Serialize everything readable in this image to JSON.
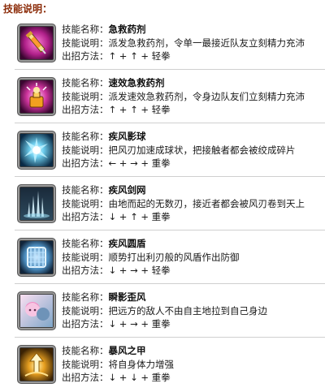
{
  "header": {
    "title": "技能说明："
  },
  "labels": {
    "name": "技能名称：",
    "desc": "技能说明：",
    "method": "出招方法："
  },
  "skills": [
    {
      "icon": "potion-syringe-icon",
      "name": "急救药剂",
      "desc": "派发急救药剂，令单一最接近队友立刻精力充沛",
      "method": "↑ + ↑ + 轻拳"
    },
    {
      "icon": "quick-potion-icon",
      "name": "速效急救药剂",
      "desc": "派发速效急救药剂，令身边队友们立刻精力充沛",
      "method": "↑ + ↑ + 轻拳"
    },
    {
      "icon": "wind-sphere-icon",
      "name": "疾风影球",
      "desc": "把风刃加速成球状，把接触者都会被绞成碎片",
      "method": "← + → + 重拳"
    },
    {
      "icon": "wind-sword-net-icon",
      "name": "疾风剑网",
      "desc": "由地而起的无数刃，接近者都会被风刃卷到天上",
      "method": "↓ + ↑ + 重拳"
    },
    {
      "icon": "wind-shield-icon",
      "name": "疾风圆盾",
      "desc": "顺势打出利刃般的风盾作出防御",
      "method": "↓ + → + 轻拳"
    },
    {
      "icon": "shadow-wind-icon",
      "name": "瞬影歪风",
      "desc": "把远方的敌人不由自主地拉到自己身边",
      "method": "↓ + → + 重拳"
    },
    {
      "icon": "storm-armor-icon",
      "name": "暴风之甲",
      "desc": "将自身体力增强",
      "method": "↓ + ↓ + 重拳"
    }
  ]
}
